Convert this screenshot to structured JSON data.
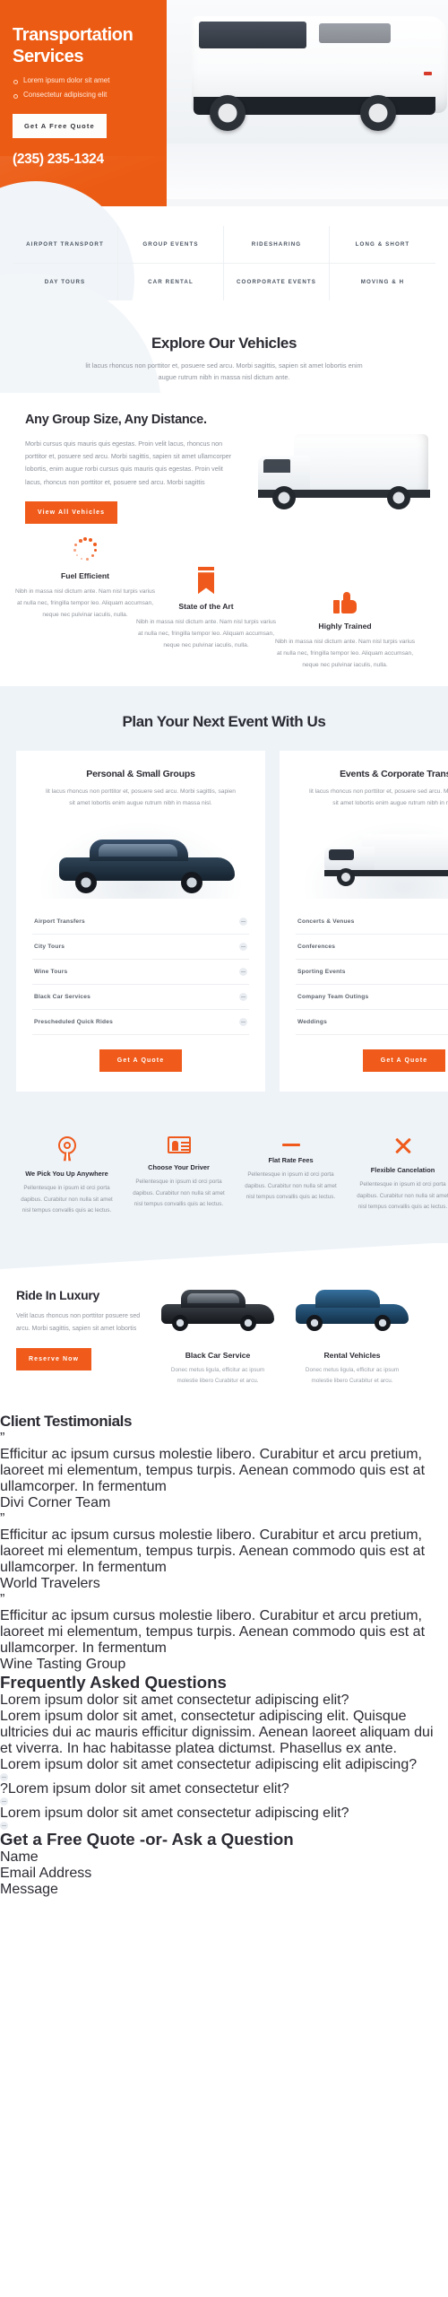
{
  "hero": {
    "title": "Transportation Services",
    "bullets": [
      "Lorem ipsum dolor sit amet",
      "Consectetur adipiscing elit"
    ],
    "cta": "Get A Free Quote",
    "phone": "(235) 235-1324",
    "photo_alt": "white-coach-bus"
  },
  "services_nav": {
    "items": [
      "AIRPORT TRANSPORT",
      "GROUP EVENTS",
      "RIDESHARING",
      "LONG & SHORT",
      "DAY TOURS",
      "CAR RENTAL",
      "COORPORATE EVENTS",
      "MOVING & H"
    ]
  },
  "explore": {
    "heading": "Explore Our Vehicles",
    "subtext": "lit lacus rhoncus non porttitor et, posuere sed arcu. Morbi sagittis, sapien sit amet lobortis enim augue rutrum nibh in massa nisl dictum ante."
  },
  "group": {
    "heading": "Any Group Size, Any Distance.",
    "body": "Morbi cursus quis mauris quis egestas. Proin velit lacus, rhoncus non porttitor et, posuere sed arcu. Morbi sagittis, sapien sit amet ullamcorper lobortis, enim augue rorbi cursus quis mauris quis egestas. Proin velit lacus, rhoncus non porttitor et, posuere sed arcu. Morbi sagittis",
    "cta": "View All Vehicles"
  },
  "features3": [
    {
      "icon": "dotted-circle-icon",
      "title": "Fuel Efficient",
      "body": "Nibh in massa nisl dictum ante. Nam nisl turpis varius at nulla nec, fringilla tempor leo. Aliquam accumsan, neque nec pulvinar iaculis, nulla."
    },
    {
      "icon": "bookmark-icon",
      "title": "State of the Art",
      "body": "Nibh in massa nisl dictum ante. Nam nisl turpis varius at nulla nec, fringilla tempor leo. Aliquam accumsan, neque nec pulvinar iaculis, nulla."
    },
    {
      "icon": "thumbs-up-icon",
      "title": "Highly Trained",
      "body": "Nibh in massa nisl dictum ante. Nam nisl turpis varius at nulla nec, fringilla tempor leo. Aliquam accumsan, neque nec pulvinar iaculis, nulla."
    }
  ],
  "plan": {
    "heading": "Plan Your Next Event With Us",
    "cards": [
      {
        "title": "Personal & Small Groups",
        "body": "lit lacus rhoncus non porttitor et, posuere sed arcu. Morbi sagittis, sapien sit amet lobortis enim augue rutrum nibh in massa nisl.",
        "image": "black-suv-photo",
        "items": [
          "Airport Transfers",
          "City Tours",
          "Wine Tours",
          "Black Car Services",
          "Prescheduled Quick Rides"
        ],
        "cta": "Get A Quote"
      },
      {
        "title": "Events & Corporate Transport",
        "body": "lit lacus rhoncus non porttitor et, posuere sed arcu. Morbi sagittis, sapien sit amet lobortis enim augue rutrum nibh in massa nisl.",
        "image": "white-shuttle-photo",
        "items": [
          "Concerts & Venues",
          "Conferences",
          "Sporting Events",
          "Company Team Outings",
          "Weddings"
        ],
        "cta": "Get A Quote"
      }
    ]
  },
  "features4": [
    {
      "icon": "map-pin-icon",
      "title": "We Pick You Up Anywhere",
      "body": "Pellentesque in ipsum id orci porta dapibus. Curabitur non nulla sit amet nisl tempus convallis quis ac lectus."
    },
    {
      "icon": "id-card-icon",
      "title": "Choose Your Driver",
      "body": "Pellentesque in ipsum id orci porta dapibus. Curabitur non nulla sit amet nisl tempus convallis quis ac lectus."
    },
    {
      "icon": "dash-icon",
      "title": "Flat Rate Fees",
      "body": "Pellentesque in ipsum id orci porta dapibus. Curabitur non nulla sit amet nisl tempus convallis quis ac lectus."
    },
    {
      "icon": "flexible-cross-icon",
      "title": "Flexible Cancelation",
      "body": "Pellentesque in ipsum id orci porta dapibus. Curabitur non nulla sit amet nisl tempus convallis quis ac lectus."
    }
  ],
  "luxury": {
    "heading": "Ride In Luxury",
    "body": "Velit lacus rhoncus non porttitor posuere sed arcu. Morbi sagittis, sapien sit amet lobortis",
    "cta": "Reserve Now",
    "items": [
      {
        "image": "black-suv-photo",
        "title": "Black Car Service",
        "body": "Donec metus ligula, efficitur ac ipsum molestie libero Curabitur et arcu."
      },
      {
        "image": "blue-suv-photo",
        "title": "Rental Vehicles",
        "body": "Donec metus ligula, efficitur ac ipsum molestie libero Curabitur et arcu."
      }
    ]
  },
  "testimonials": {
    "heading": "Client Testimonials",
    "items": [
      {
        "quote": "Efficitur ac ipsum cursus molestie libero. Curabitur et arcu pretium, laoreet mi elementum, tempus turpis. Aenean commodo quis est at ullamcorper. In fermentum",
        "author": "Divi Corner Team"
      },
      {
        "quote": "Efficitur ac ipsum cursus molestie libero. Curabitur et arcu pretium, laoreet mi elementum, tempus turpis. Aenean commodo quis est at ullamcorper. In fermentum",
        "author": "World Travelers"
      },
      {
        "quote": "Efficitur ac ipsum cursus molestie libero. Curabitur et arcu pretium, laoreet mi elementum, tempus turpis. Aenean commodo quis est at ullamcorper. In fermentum",
        "author": "Wine Tasting Group"
      }
    ]
  },
  "faq": {
    "heading": "Frequently Asked Questions",
    "items": [
      {
        "question": "Lorem ipsum dolor sit amet consectetur adipiscing elit?",
        "answer": "Lorem ipsum dolor sit amet, consectetur adipiscing elit. Quisque ultricies dui ac mauris efficitur dignissim. Aenean laoreet aliquam dui et viverra. In hac habitasse platea dictumst. Phasellus ex ante.",
        "open": true
      },
      {
        "question": "Lorem ipsum dolor sit amet consectetur adipiscing elit adipiscing?",
        "answer": "",
        "open": false
      },
      {
        "question": "?Lorem ipsum dolor sit amet consectetur elit?",
        "answer": "",
        "open": false
      },
      {
        "question": "Lorem ipsum dolor sit amet consectetur adipiscing elit?",
        "answer": "",
        "open": false
      }
    ]
  },
  "quote_form": {
    "heading": "Get a Free Quote -or- Ask a Question",
    "name_placeholder": "Name",
    "email_placeholder": "Email Address",
    "message_placeholder": "Message"
  },
  "colors": {
    "brand_orange": "#ec5b13",
    "button_orange": "#f05a1a",
    "dark_panel": "#23262a",
    "light_blue_bg": "#eef3f8",
    "heading_dark": "#2b2b33",
    "muted_text": "#8f949c"
  }
}
